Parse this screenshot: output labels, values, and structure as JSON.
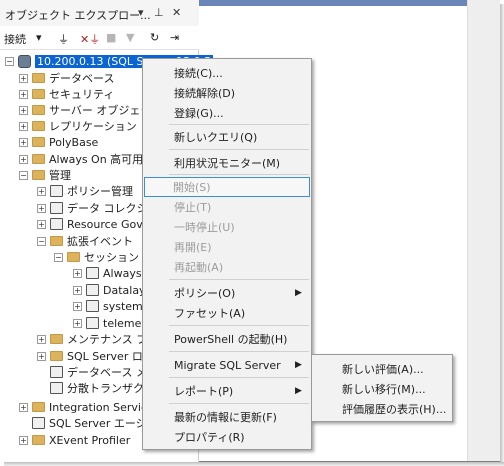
{
  "panel": {
    "title": "オブジェクト エクスプロー...",
    "toolbar": {
      "connect_label": "接続"
    }
  },
  "tree": [
    {
      "label": "10.200.0.13 (SQL Server 13.0.5",
      "type": "server",
      "expander": "-",
      "selected": true
    },
    {
      "label": "データベース",
      "type": "folder",
      "expander": "+"
    },
    {
      "label": "セキュリティ",
      "type": "folder",
      "expander": "+"
    },
    {
      "label": "サーバー オブジェクト",
      "type": "folder",
      "expander": "+"
    },
    {
      "label": "レプリケーション",
      "type": "folder",
      "expander": "+"
    },
    {
      "label": "PolyBase",
      "type": "folder",
      "expander": "+"
    },
    {
      "label": "Always On 高可用",
      "type": "folder",
      "expander": "+"
    },
    {
      "label": "管理",
      "type": "folder",
      "expander": "-"
    },
    {
      "label": "ポリシー管理",
      "type": "item",
      "expander": "+"
    },
    {
      "label": "データ コレクション",
      "type": "item",
      "expander": "+"
    },
    {
      "label": "Resource Gove",
      "type": "item",
      "expander": "+"
    },
    {
      "label": "拡張イベント",
      "type": "folder",
      "expander": "-"
    },
    {
      "label": "セッション",
      "type": "folder",
      "expander": "-"
    },
    {
      "label": "Always",
      "type": "item",
      "expander": "+"
    },
    {
      "label": "Datalay",
      "type": "item",
      "expander": "+"
    },
    {
      "label": "system",
      "type": "item",
      "expander": "+"
    },
    {
      "label": "teleme",
      "type": "item",
      "expander": "+"
    },
    {
      "label": "メンテナンス プ",
      "type": "folder",
      "expander": "+"
    },
    {
      "label": "SQL Server ログ",
      "type": "folder",
      "expander": "+"
    },
    {
      "label": "データベース メー",
      "type": "item",
      "expander": ""
    },
    {
      "label": "分散トランザクシ",
      "type": "item",
      "expander": ""
    },
    {
      "label": "Integration Servic",
      "type": "folder",
      "expander": "+"
    },
    {
      "label": "SQL Server エージェ",
      "type": "item",
      "expander": ""
    },
    {
      "label": "XEvent Profiler",
      "type": "folder",
      "expander": "+"
    }
  ],
  "context_menu": [
    {
      "label": "接続(C)...",
      "disabled": false,
      "submenu": false
    },
    {
      "label": "接続解除(D)",
      "disabled": false,
      "submenu": false
    },
    {
      "label": "登録(G)...",
      "disabled": false,
      "submenu": false
    },
    {
      "label": "新しいクエリ(Q)",
      "disabled": false,
      "submenu": false
    },
    {
      "label": "利用状況モニター(M)",
      "disabled": false,
      "submenu": false
    },
    {
      "label": "開始(S)",
      "disabled": true,
      "submenu": false,
      "highlighted": true
    },
    {
      "label": "停止(T)",
      "disabled": true,
      "submenu": false
    },
    {
      "label": "一時停止(U)",
      "disabled": true,
      "submenu": false
    },
    {
      "label": "再開(E)",
      "disabled": true,
      "submenu": false
    },
    {
      "label": "再起動(A)",
      "disabled": true,
      "submenu": false
    },
    {
      "label": "ポリシー(O)",
      "disabled": false,
      "submenu": true
    },
    {
      "label": "ファセット(A)",
      "disabled": false,
      "submenu": false
    },
    {
      "label": "PowerShell の起動(H)",
      "disabled": false,
      "submenu": false
    },
    {
      "label": "Migrate SQL Server",
      "disabled": false,
      "submenu": true
    },
    {
      "label": "レポート(P)",
      "disabled": false,
      "submenu": true
    },
    {
      "label": "最新の情報に更新(F)",
      "disabled": false,
      "submenu": false
    },
    {
      "label": "プロパティ(R)",
      "disabled": false,
      "submenu": false
    }
  ],
  "submenu": [
    {
      "label": "新しい評価(A)..."
    },
    {
      "label": "新しい移行(M)..."
    },
    {
      "label": "評価履歴の表示(H)..."
    }
  ],
  "colors": {
    "selection": "#0a64d2",
    "menu_bg": "#f2f2f2",
    "highlight_border": "#3c8de0",
    "folder": "#dcb35c"
  }
}
